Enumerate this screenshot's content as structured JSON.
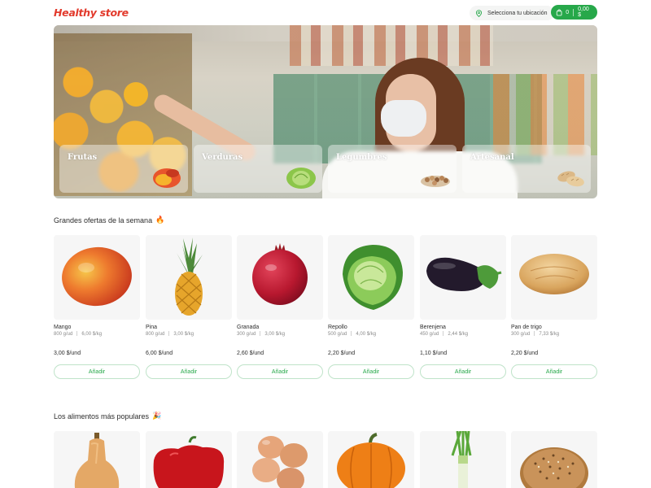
{
  "header": {
    "logo": "Healthy store",
    "location_label": "Selecciona tu ubicación",
    "cart_count": "0",
    "cart_total": "0,00 $"
  },
  "hero": {
    "categories": [
      {
        "label": "Frutas",
        "icon": "mango-icon"
      },
      {
        "label": "Verduras",
        "icon": "cabbage-icon"
      },
      {
        "label": "Legumbres",
        "icon": "beans-icon"
      },
      {
        "label": "Artesanal",
        "icon": "bread-icon"
      }
    ]
  },
  "offers": {
    "title": "Grandes ofertas de la semana",
    "emoji": "🔥",
    "add_label": "Añadir",
    "products": [
      {
        "name": "Mango",
        "weight": "800 g/ud",
        "per_kg": "6,00 $/kg",
        "price": "3,00 $/und",
        "icon": "mango-icon"
      },
      {
        "name": "Pina",
        "weight": "800 g/ud",
        "per_kg": "3,00 $/kg",
        "price": "6,00 $/und",
        "icon": "pineapple-icon"
      },
      {
        "name": "Granada",
        "weight": "300 g/ud",
        "per_kg": "3,00 $/kg",
        "price": "2,60 $/und",
        "icon": "pomegranate-icon"
      },
      {
        "name": "Repollo",
        "weight": "500 g/ud",
        "per_kg": "4,00 $/kg",
        "price": "2,20 $/und",
        "icon": "cabbage-icon"
      },
      {
        "name": "Berenjena",
        "weight": "450 g/ud",
        "per_kg": "2,44 $/kg",
        "price": "1,10 $/und",
        "icon": "eggplant-icon"
      },
      {
        "name": "Pan de trigo",
        "weight": "300 g/ud",
        "per_kg": "7,33 $/kg",
        "price": "2,20 $/und",
        "icon": "bread-icon"
      }
    ]
  },
  "popular": {
    "title": "Los alimentos más populares",
    "emoji": "🎉",
    "products": [
      {
        "icon": "butternut-squash-icon"
      },
      {
        "icon": "red-pepper-icon"
      },
      {
        "icon": "eggs-icon"
      },
      {
        "icon": "pumpkin-icon"
      },
      {
        "icon": "leek-icon"
      },
      {
        "icon": "seeded-bread-icon"
      }
    ]
  },
  "colors": {
    "brand_red": "#e23a2c",
    "accent_green": "#27a84a"
  }
}
